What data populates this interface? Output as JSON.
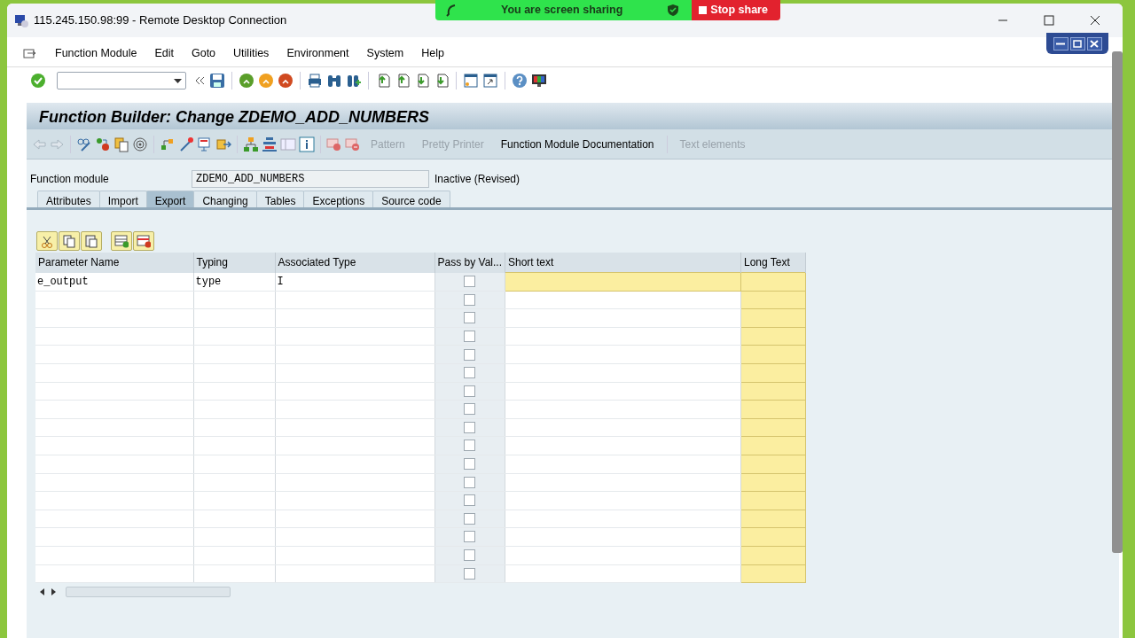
{
  "remote_window": {
    "title": "115.245.150.98:99 - Remote Desktop Connection"
  },
  "screen_share": {
    "message": "You are screen sharing",
    "stop_label": "Stop share"
  },
  "menu": [
    "Function Module",
    "Edit",
    "Goto",
    "Utilities",
    "Environment",
    "System",
    "Help"
  ],
  "title": "Function Builder: Change ZDEMO_ADD_NUMBERS",
  "app_toolbar": [
    {
      "label": "Pattern",
      "disabled": true
    },
    {
      "label": "Pretty Printer",
      "disabled": true
    },
    {
      "label": "Function Module Documentation",
      "disabled": false
    },
    {
      "label": "Text elements",
      "disabled": true
    }
  ],
  "function_module": {
    "label": "Function module",
    "value": "ZDEMO_ADD_NUMBERS",
    "status": "Inactive (Revised)"
  },
  "tabs": [
    {
      "label": "Attributes",
      "selected": false
    },
    {
      "label": "Import",
      "selected": false
    },
    {
      "label": "Export",
      "selected": true
    },
    {
      "label": "Changing",
      "selected": false
    },
    {
      "label": "Tables",
      "selected": false
    },
    {
      "label": "Exceptions",
      "selected": false
    },
    {
      "label": "Source code",
      "selected": false
    }
  ],
  "table": {
    "columns": [
      "Parameter Name",
      "Typing",
      "Associated Type",
      "Pass by Val...",
      "Short text",
      "Long Text"
    ],
    "rows": [
      {
        "parameter_name": "e_output",
        "typing": "type",
        "associated_type": "I",
        "pass_by_value": false,
        "editable": true
      },
      {
        "pass_by_value": false,
        "editable": false
      },
      {
        "pass_by_value": false,
        "editable": false
      },
      {
        "pass_by_value": false,
        "editable": false
      },
      {
        "pass_by_value": false,
        "editable": false
      },
      {
        "pass_by_value": false,
        "editable": false
      },
      {
        "pass_by_value": false,
        "editable": false
      },
      {
        "pass_by_value": false,
        "editable": false
      },
      {
        "pass_by_value": false,
        "editable": false
      },
      {
        "pass_by_value": false,
        "editable": false
      },
      {
        "pass_by_value": false,
        "editable": false
      },
      {
        "pass_by_value": false,
        "editable": false
      },
      {
        "pass_by_value": false,
        "editable": false
      },
      {
        "pass_by_value": false,
        "editable": false
      },
      {
        "pass_by_value": false,
        "editable": false
      },
      {
        "pass_by_value": false,
        "editable": false
      },
      {
        "pass_by_value": false,
        "editable": false
      }
    ]
  }
}
